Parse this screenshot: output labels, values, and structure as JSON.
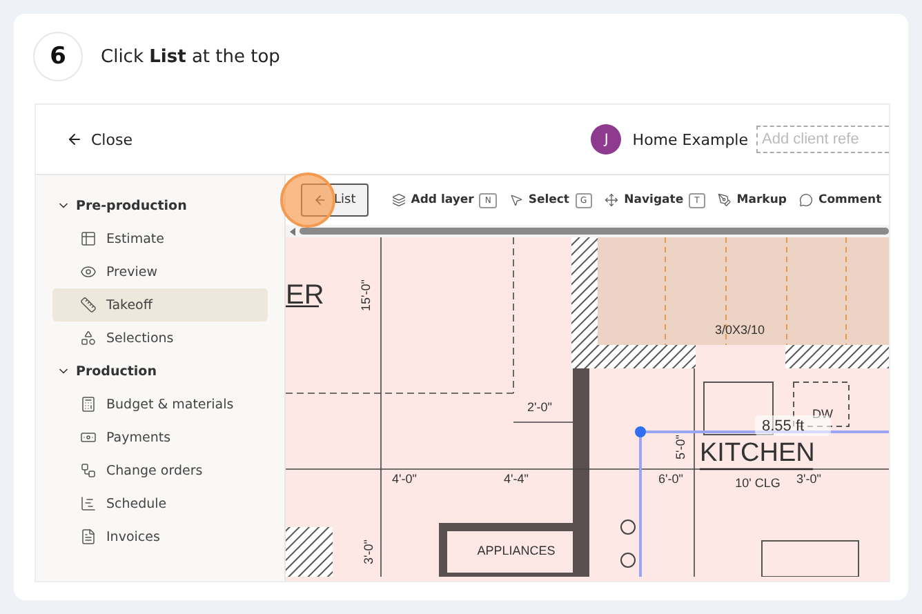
{
  "step": {
    "number": "6",
    "instruction": "Click **List** at the top"
  },
  "app": {
    "close_label": "Close",
    "project": {
      "avatar_letter": "J",
      "name": "Home Example",
      "client_reference_placeholder": "Add client refe"
    },
    "sidebar": {
      "sections": [
        {
          "label": "Pre-production",
          "expanded": true,
          "items": [
            {
              "label": "Estimate",
              "selected": false
            },
            {
              "label": "Preview",
              "selected": false
            },
            {
              "label": "Takeoff",
              "selected": true
            },
            {
              "label": "Selections",
              "selected": false
            }
          ]
        },
        {
          "label": "Production",
          "expanded": true,
          "items": [
            {
              "label": "Budget & materials",
              "selected": false
            },
            {
              "label": "Payments",
              "selected": false
            },
            {
              "label": "Change orders",
              "selected": false
            },
            {
              "label": "Schedule",
              "selected": false
            },
            {
              "label": "Invoices",
              "selected": false
            }
          ]
        }
      ]
    },
    "toolbar": {
      "back_button": "List",
      "highlighted": true,
      "tools": [
        {
          "label": "Add layer",
          "shortcut": "N"
        },
        {
          "label": "Select",
          "shortcut": "G"
        },
        {
          "label": "Navigate",
          "shortcut": "T"
        },
        {
          "label": "Markup"
        },
        {
          "label": "Comment"
        }
      ]
    },
    "plan": {
      "labels": [
        "ER",
        "15'-0\"",
        "3/0X3/10",
        "DW",
        "2'-0\"",
        "KITCHEN",
        "5'-0\"",
        "4'-0\"",
        "4'-4\"",
        "6'-0\"",
        "10' CLG",
        "3'-0\"",
        "APPLIANCES",
        "3'-0\""
      ],
      "measurement": "8.55 ft"
    }
  }
}
